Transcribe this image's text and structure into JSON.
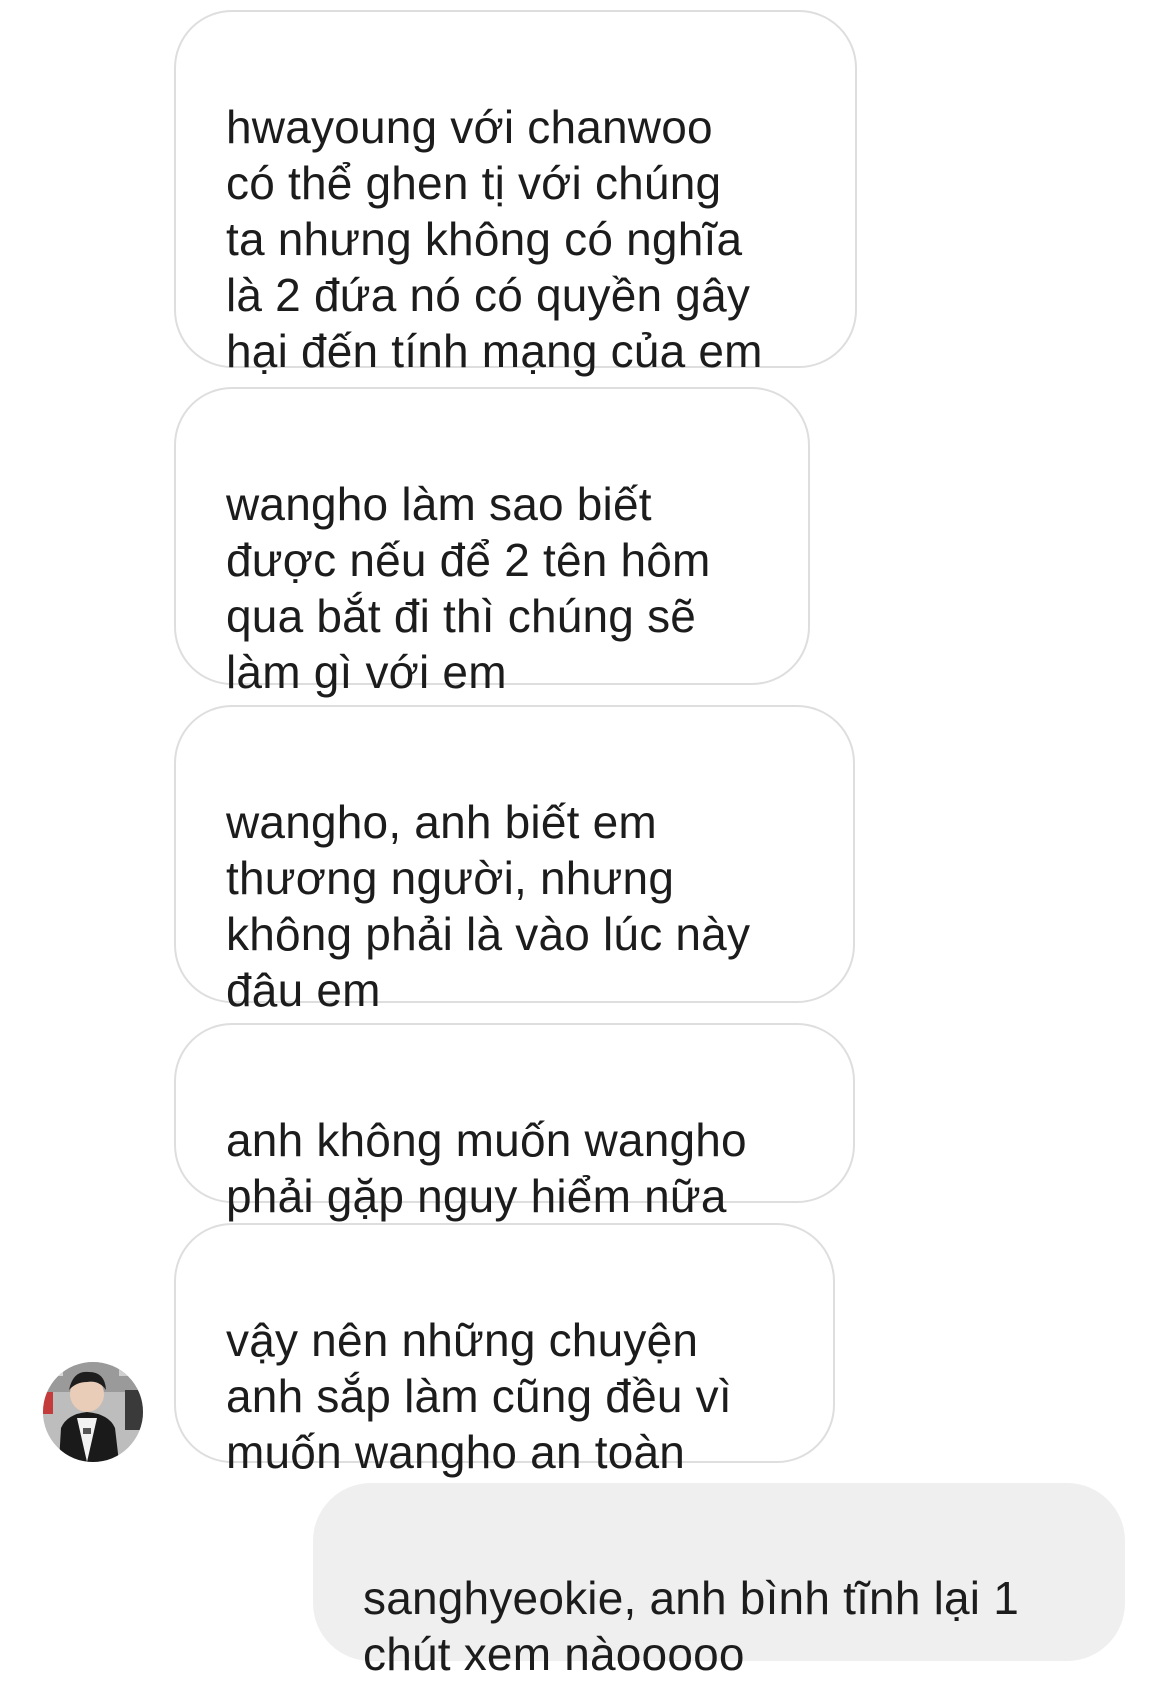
{
  "conversation": {
    "messages": [
      {
        "direction": "incoming",
        "text": "hwayoung với chanwoo\ncó thể ghen tị với chúng\nta nhưng không có nghĩa\nlà 2 đứa nó có quyền gây\nhại đến tính mạng của em"
      },
      {
        "direction": "incoming",
        "text": "wangho làm sao biết\nđược nếu để 2 tên hôm\nqua bắt đi thì chúng sẽ\nlàm gì với em"
      },
      {
        "direction": "incoming",
        "text": "wangho, anh biết em\nthương người, nhưng\nkhông phải là vào lúc này\nđâu em"
      },
      {
        "direction": "incoming",
        "text": "anh không muốn wangho\nphải gặp nguy hiểm nữa"
      },
      {
        "direction": "incoming",
        "text": "vậy nên những chuyện\nanh sắp làm cũng đều vì\nmuốn wangho an toàn"
      },
      {
        "direction": "outgoing",
        "text": "sanghyeokie, anh bình tĩnh lại 1\nchút xem nàooooo"
      }
    ],
    "sender_avatar": {
      "icon": "user-avatar-photo"
    }
  },
  "colors": {
    "incoming_bubble_bg": "#ffffff",
    "incoming_bubble_border": "#dedede",
    "outgoing_bubble_bg": "#efefef",
    "text": "#1c1c1c"
  }
}
